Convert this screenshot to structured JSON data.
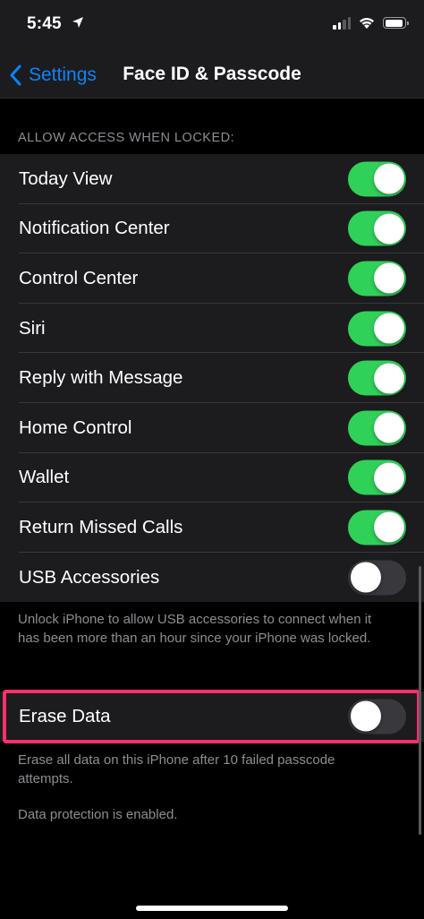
{
  "status_bar": {
    "time": "5:45"
  },
  "nav": {
    "back_label": "Settings",
    "title": "Face ID & Passcode"
  },
  "section_header": "ALLOW ACCESS WHEN LOCKED:",
  "rows": [
    {
      "label": "Today View",
      "on": true
    },
    {
      "label": "Notification Center",
      "on": true
    },
    {
      "label": "Control Center",
      "on": true
    },
    {
      "label": "Siri",
      "on": true
    },
    {
      "label": "Reply with Message",
      "on": true
    },
    {
      "label": "Home Control",
      "on": true
    },
    {
      "label": "Wallet",
      "on": true
    },
    {
      "label": "Return Missed Calls",
      "on": true
    },
    {
      "label": "USB Accessories",
      "on": false
    }
  ],
  "usb_footer": "Unlock iPhone to allow USB accessories to connect when it has been more than an hour since your iPhone was locked.",
  "erase": {
    "label": "Erase Data",
    "on": false
  },
  "erase_footer": "Erase all data on this iPhone after 10 failed passcode attempts.",
  "data_protection": "Data protection is enabled.",
  "colors": {
    "accent": "#0a84ff",
    "toggle_on": "#30d158",
    "highlight": "#ff2f6c"
  }
}
